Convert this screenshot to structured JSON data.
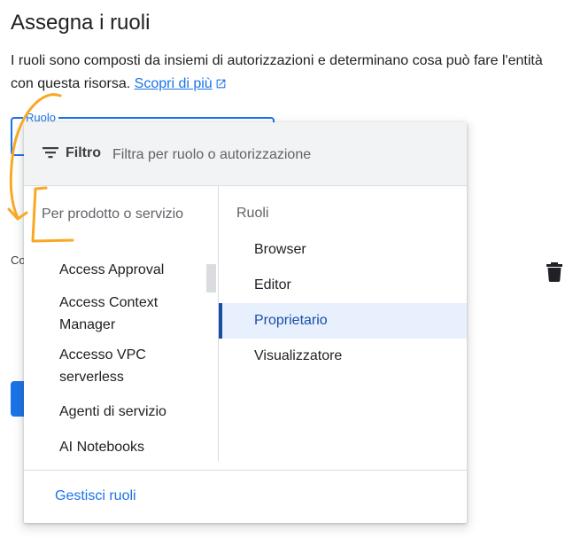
{
  "page": {
    "title": "Assegna i ruoli",
    "description": "I ruoli sono composti da insiemi di autorizzazioni e determinano cosa può fare l'entità con questa risorsa.",
    "learn_more": "Scopri di più"
  },
  "role_field": {
    "label": "Ruolo"
  },
  "condition_label": "Co",
  "filter": {
    "label": "Filtro",
    "placeholder": "Filtra per ruolo o autorizzazione"
  },
  "products": {
    "heading": "Per prodotto o servizio",
    "items": [
      "Access Approval",
      "Access Context Manager",
      "Accesso VPC serverless",
      "Agenti di servizio",
      "AI Notebooks"
    ]
  },
  "roles": {
    "heading": "Ruoli",
    "items": [
      "Browser",
      "Editor",
      "Proprietario",
      "Visualizzatore"
    ],
    "selected": "Proprietario"
  },
  "footer": {
    "manage_roles": "Gestisci ruoli"
  },
  "colors": {
    "accent": "#1a73e8",
    "selected_text": "#174ea6",
    "selected_bg": "#e8f0fe",
    "annotation": "#f9a825"
  },
  "icons": {
    "filter": "filter-icon",
    "external_link": "external-link-icon",
    "delete": "trash-icon"
  }
}
